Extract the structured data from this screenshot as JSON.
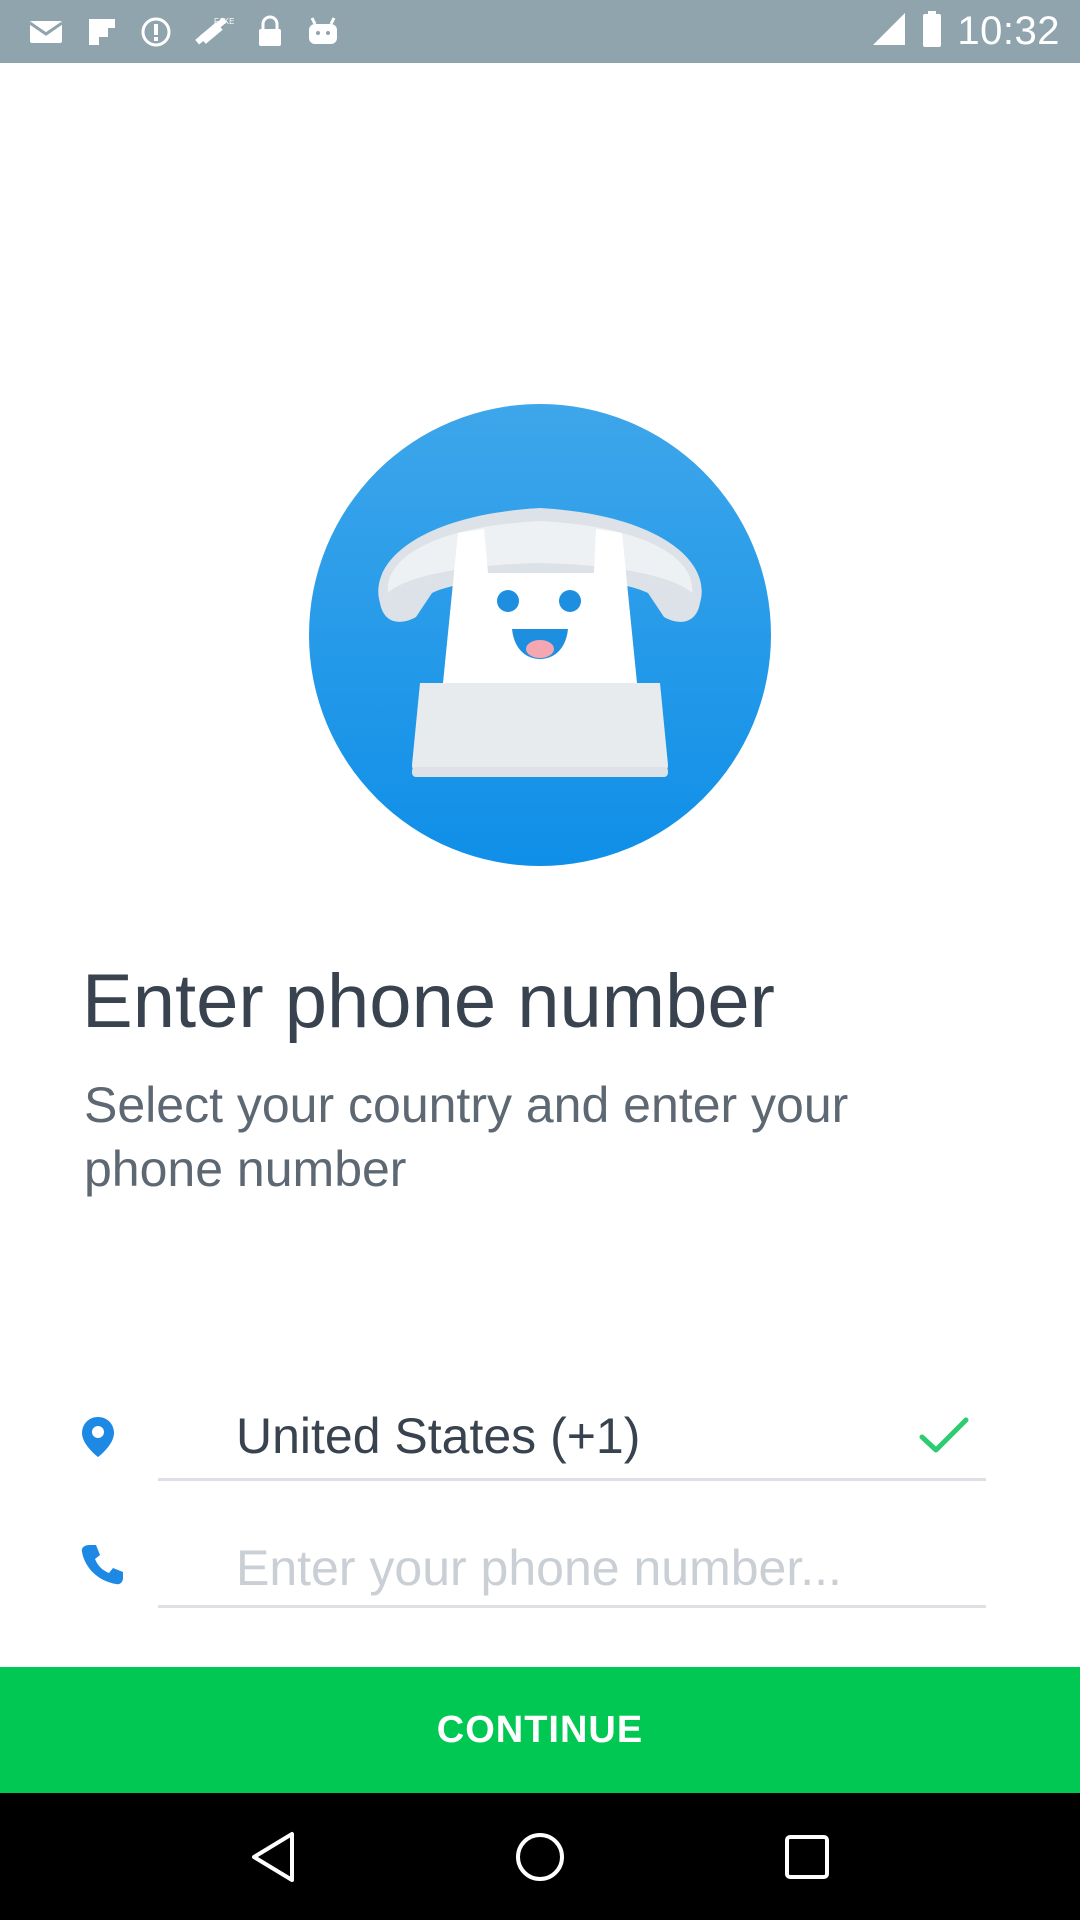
{
  "status_bar": {
    "time": "10:32",
    "left_icons": [
      "mail-icon",
      "flipboard-icon",
      "alert-icon",
      "fake-gps-icon",
      "lock-icon",
      "android-icon"
    ],
    "right_icons": [
      "signal-icon",
      "battery-icon"
    ],
    "background": "#90a4ae"
  },
  "hero": {
    "icon": "smiling-telephone-icon",
    "circle_color": "#1e96eb"
  },
  "header": {
    "title": "Enter phone number",
    "subtitle": "Select your country and enter your phone number"
  },
  "form": {
    "country": {
      "icon": "location-pin-icon",
      "value": "United States (+1)",
      "status_icon": "checkmark-icon"
    },
    "phone": {
      "icon": "phone-icon",
      "value": "",
      "placeholder": "Enter your phone number..."
    }
  },
  "actions": {
    "continue_label": "CONTINUE",
    "continue_color": "#00c853"
  },
  "nav_bar": {
    "buttons": [
      "back-icon",
      "home-icon",
      "recents-icon"
    ]
  }
}
